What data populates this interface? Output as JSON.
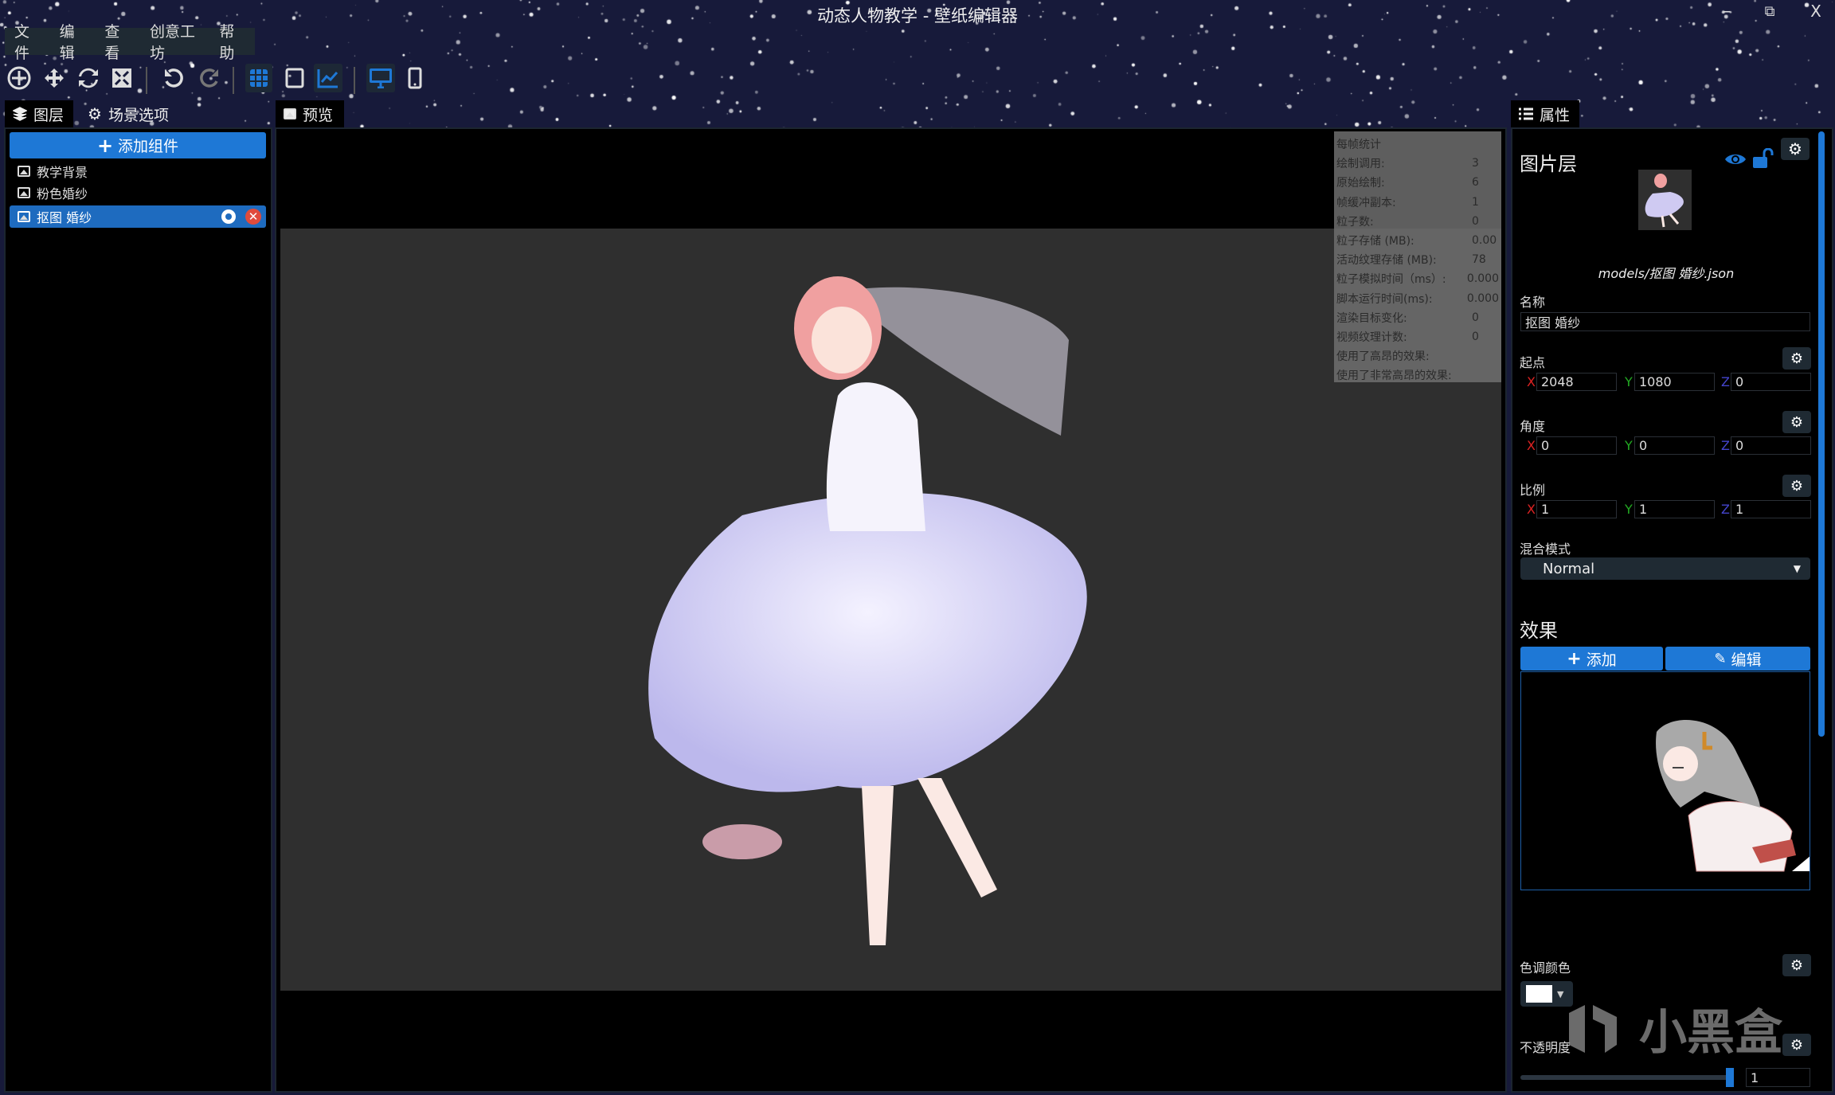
{
  "window": {
    "title": "动态人物教学 - 壁纸编辑器",
    "minimize": "–",
    "restore": "⧉",
    "close": "X"
  },
  "menu": [
    "文件",
    "编辑",
    "查看",
    "创意工坊",
    "帮助"
  ],
  "toolbar": {
    "icons": [
      "move-gizmo-icon",
      "translate-icon",
      "rotate-icon",
      "scale-icon",
      "undo-icon",
      "redo-icon",
      "grid-icon",
      "frame-icon",
      "stats-chart-icon",
      "desktop-icon",
      "mobile-icon"
    ],
    "accent": "#1e78d6"
  },
  "left": {
    "tabs": [
      "图层",
      "场景选项"
    ],
    "add_component": "添加组件",
    "layers": [
      {
        "name": "教学背景"
      },
      {
        "name": "粉色婚纱"
      },
      {
        "name": "抠图 婚纱",
        "selected": true
      }
    ]
  },
  "center": {
    "tab": "预览",
    "canvas_bg": "#2f2f2f"
  },
  "stats": {
    "title": "每帧统计",
    "rows": [
      {
        "k": "绘制调用:",
        "v": "3"
      },
      {
        "k": "原始绘制:",
        "v": "6"
      },
      {
        "k": "帧缓冲副本:",
        "v": "1"
      },
      {
        "k": "粒子数:",
        "v": "0"
      },
      {
        "k": "粒子存储 (MB):",
        "v": "0.00"
      },
      {
        "k": "活动纹理存储 (MB):",
        "v": "78"
      },
      {
        "k": "粒子模拟时间（ms）:",
        "v": "0.000"
      },
      {
        "k": "脚本运行时间(ms):",
        "v": "0.000"
      },
      {
        "k": "渲染目标变化:",
        "v": "0"
      },
      {
        "k": "视频纹理计数:",
        "v": "0"
      },
      {
        "k": "使用了高昂的效果:",
        "v": ""
      },
      {
        "k": "使用了非常高昂的效果:",
        "v": ""
      }
    ]
  },
  "props": {
    "tab": "属性",
    "title": "图片层",
    "model_path": "models/抠图 婚纱.json",
    "name_label": "名称",
    "name_value": "抠图  婚纱",
    "origin": {
      "label": "起点",
      "x": "2048",
      "y": "1080",
      "z": "0"
    },
    "angles": {
      "label": "角度",
      "x": "0",
      "y": "0",
      "z": "0"
    },
    "scale": {
      "label": "比例",
      "x": "1",
      "y": "1",
      "z": "1"
    },
    "axis": {
      "x": "X",
      "y": "Y",
      "z": "Z"
    },
    "blend_label": "混合模式",
    "blend_value": "Normal",
    "effects_title": "效果",
    "effects_add": "添加",
    "effects_edit": "编辑",
    "tint_label": "色调颜色",
    "tint_color": "#ffffff",
    "opacity_label": "不透明度",
    "opacity_value": "1",
    "opacity_fraction": 1
  },
  "watermark": "小黑盒"
}
